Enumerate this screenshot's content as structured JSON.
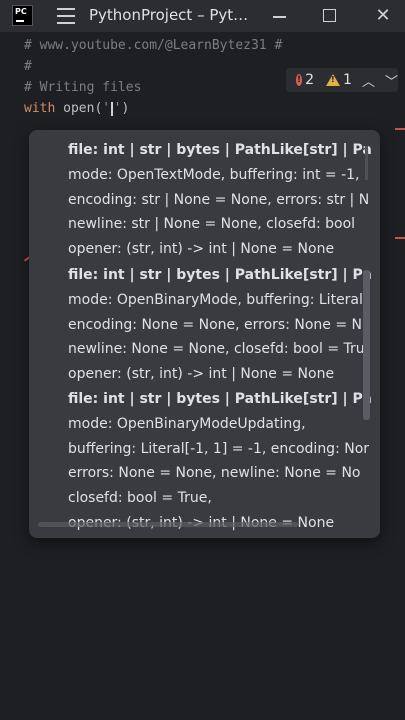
{
  "titlebar": {
    "logo_text": "PC",
    "title": "PythonProject – Pyt…"
  },
  "editor": {
    "lines": [
      "# www.youtube.com/@LearnBytez31 #",
      "#",
      "# Writing files"
    ],
    "code": {
      "keyword": "with",
      "func": "open",
      "open_paren": "(",
      "quote_open": "'",
      "quote_close": "'",
      "close_paren": ")"
    }
  },
  "inspections": {
    "errors": "2",
    "warnings": "1"
  },
  "popup": {
    "signatures": [
      {
        "lines": [
          "file: int | str | bytes | PathLike[str] | PathLike",
          "mode: OpenTextMode, buffering: int = -1,",
          "encoding: str | None = None, errors: str | N",
          "newline: str | None = None, closefd: bool",
          "opener: (str, int) -> int | None = None"
        ]
      },
      {
        "lines": [
          "file: int | str | bytes | PathLike[str] | PathLike",
          "mode: OpenBinaryMode, buffering: Literal[",
          "encoding: None = None, errors: None = N",
          "newline: None = None, closefd: bool = Tru",
          "opener: (str, int) -> int | None = None"
        ]
      },
      {
        "lines": [
          "file: int | str | bytes | PathLike[str] | PathLike",
          "mode: OpenBinaryModeUpdating,",
          "buffering: Literal[-1, 1] = -1, encoding: Nor",
          "errors: None = None, newline: None = No",
          "closefd: bool = True,",
          "opener: (str, int) -> int | None = None"
        ]
      }
    ]
  }
}
